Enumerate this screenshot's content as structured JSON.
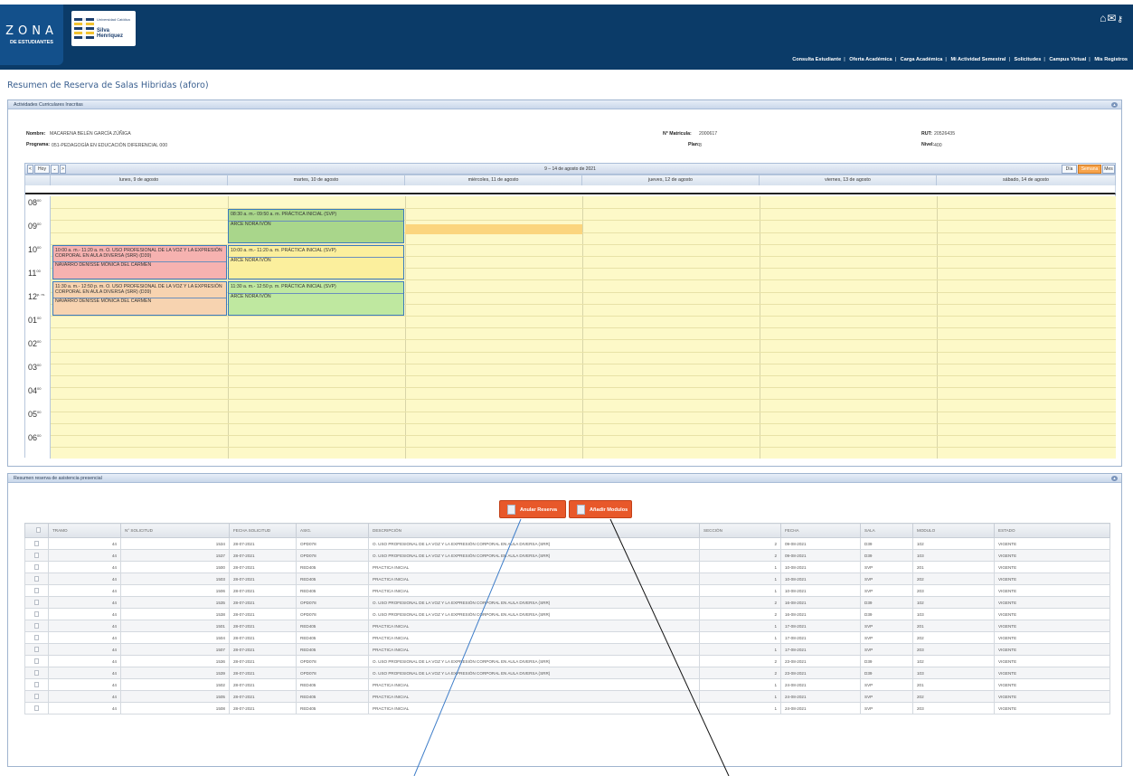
{
  "header": {
    "zona_title": "ZONA",
    "zona_subtitle": "DE ESTUDIANTES",
    "university_small": "Universidad Católica",
    "university_name": "Silva Henríquez",
    "icons": [
      "home-icon",
      "mail-icon",
      "key-icon"
    ],
    "nav": [
      "Consulta Estudiante",
      "Oferta Académica",
      "Carga Académica",
      "Mi Actividad Semestral",
      "Solicitudes",
      "Campus Virtual",
      "Mis Registros"
    ]
  },
  "page_title": "Resumen de Reserva de Salas Hibridas (aforo)",
  "panel1": {
    "title": "Actividades Curriculares Inscritas",
    "nombre_label": "Nombre:",
    "nombre": "MACARENA BELÉN GARCÍA ZÚÑIGA",
    "programa_label": "Programa:",
    "programa": "051-PEDAGOGÍA EN EDUCACIÓN DIFERENCIAL 000",
    "matricula_label": "N° Matricula:",
    "matricula": "2000617",
    "plan_label": "Plan:",
    "plan": "8",
    "rut_label": "RUT:",
    "rut": "20526435",
    "nivel_label": "Nivel:",
    "nivel": "400"
  },
  "calendar": {
    "prev": "<",
    "today": "Hoy",
    "down": "⌄",
    "next": ">",
    "range": "9 – 14 de agosto de 2021",
    "views": [
      "Día",
      "Semana Laboral",
      "Mes"
    ],
    "days": [
      "lunes, 9 de agosto",
      "martes, 10 de agosto",
      "miércoles, 11 de agosto",
      "jueves, 12 de agosto",
      "viernes, 13 de agosto",
      "sábado, 14 de agosto"
    ],
    "hours": [
      "08",
      "09",
      "10",
      "11",
      "12",
      "01",
      "02",
      "03",
      "04",
      "05",
      "06"
    ],
    "hour_suffix": [
      "00",
      "00",
      "00",
      "00",
      "p. m.",
      "00",
      "00",
      "00",
      "00",
      "00",
      "00"
    ],
    "events": [
      {
        "title": "08:30 a. m.- 09:50 a. m. PRÁCTICA INICIAL (SVP)",
        "who": "ARCE NORA IVÓN"
      },
      {
        "title": "10:00 a. m.- 11:20 a. m. O. USO PROFESIONAL DE LA VOZ Y LA EXPRESIÓN CORPORAL EN AULA DIVERSA (SRR) (D39)",
        "who": "NAVARRO DENISSE MÓNICA DEL CARMEN"
      },
      {
        "title": "10:00 a. m.- 11:20 a. m. PRÁCTICA INICIAL (SVP)",
        "who": "ARCE NORA IVÓN"
      },
      {
        "title": "11:30 a. m.- 12:50 p. m. O. USO PROFESIONAL DE LA VOZ Y LA EXPRESIÓN CORPORAL EN AULA DIVERSA (SRR) (D39)",
        "who": "NAVARRO DENISSE MÓNICA DEL CARMEN"
      },
      {
        "title": "11:30 a. m.- 12:50 p. m. PRÁCTICA INICIAL (SVP)",
        "who": "ARCE NORA IVÓN"
      }
    ]
  },
  "panel2": {
    "title": "Resumen reserva de asistencia presencial",
    "btn_anular": "Anular Reserva",
    "btn_anadir": "Añadir Modulos"
  },
  "table": {
    "headers": [
      "",
      "TRAMO",
      "N° SOLICITUD",
      "FECHA SOLICITUD",
      "ASIG.",
      "DESCRIPCIÓN",
      "SECCIÓN",
      "FECHA",
      "SALA",
      "MODULO",
      "ESTADO"
    ],
    "rows": [
      [
        "44",
        "1534",
        "28-07-2021",
        "OPD078",
        "O. USO PROFESIONAL DE LA VOZ Y LA EXPRESIÓN CORPORAL EN AULA DIVERSA (SRR)",
        "2",
        "09-08-2021",
        "D39",
        "102",
        "VIGENTE"
      ],
      [
        "44",
        "1537",
        "28-07-2021",
        "OPD078",
        "O. USO PROFESIONAL DE LA VOZ Y LA EXPRESIÓN CORPORAL EN AULA DIVERSA (SRR)",
        "2",
        "09-08-2021",
        "D39",
        "103",
        "VIGENTE"
      ],
      [
        "44",
        "1500",
        "28-07-2021",
        "RED405",
        "PRACTICA INICIAL",
        "1",
        "10-08-2021",
        "SVP",
        "201",
        "VIGENTE"
      ],
      [
        "44",
        "1503",
        "28-07-2021",
        "RED405",
        "PRACTICA INICIAL",
        "1",
        "10-08-2021",
        "SVP",
        "202",
        "VIGENTE"
      ],
      [
        "44",
        "1506",
        "28-07-2021",
        "RED405",
        "PRACTICA INICIAL",
        "1",
        "10-08-2021",
        "SVP",
        "203",
        "VIGENTE"
      ],
      [
        "44",
        "1535",
        "28-07-2021",
        "OPD078",
        "O. USO PROFESIONAL DE LA VOZ Y LA EXPRESIÓN CORPORAL EN AULA DIVERSA (SRR)",
        "2",
        "16-08-2021",
        "D39",
        "102",
        "VIGENTE"
      ],
      [
        "44",
        "1538",
        "28-07-2021",
        "OPD078",
        "O. USO PROFESIONAL DE LA VOZ Y LA EXPRESIÓN CORPORAL EN AULA DIVERSA (SRR)",
        "2",
        "16-08-2021",
        "D39",
        "103",
        "VIGENTE"
      ],
      [
        "44",
        "1501",
        "28-07-2021",
        "RED405",
        "PRACTICA INICIAL",
        "1",
        "17-08-2021",
        "SVP",
        "201",
        "VIGENTE"
      ],
      [
        "44",
        "1504",
        "28-07-2021",
        "RED405",
        "PRACTICA INICIAL",
        "1",
        "17-08-2021",
        "SVP",
        "202",
        "VIGENTE"
      ],
      [
        "44",
        "1507",
        "28-07-2021",
        "RED405",
        "PRACTICA INICIAL",
        "1",
        "17-08-2021",
        "SVP",
        "203",
        "VIGENTE"
      ],
      [
        "44",
        "1536",
        "28-07-2021",
        "OPD078",
        "O. USO PROFESIONAL DE LA VOZ Y LA EXPRESIÓN CORPORAL EN AULA DIVERSA (SRR)",
        "2",
        "23-08-2021",
        "D39",
        "102",
        "VIGENTE"
      ],
      [
        "44",
        "1539",
        "28-07-2021",
        "OPD078",
        "O. USO PROFESIONAL DE LA VOZ Y LA EXPRESIÓN CORPORAL EN AULA DIVERSA (SRR)",
        "2",
        "23-08-2021",
        "D39",
        "103",
        "VIGENTE"
      ],
      [
        "44",
        "1502",
        "28-07-2021",
        "RED405",
        "PRACTICA INICIAL",
        "1",
        "24-08-2021",
        "SVP",
        "201",
        "VIGENTE"
      ],
      [
        "44",
        "1505",
        "28-07-2021",
        "RED405",
        "PRACTICA INICIAL",
        "1",
        "24-08-2021",
        "SVP",
        "202",
        "VIGENTE"
      ],
      [
        "44",
        "1508",
        "28-07-2021",
        "RED405",
        "PRACTICA INICIAL",
        "1",
        "24-08-2021",
        "SVP",
        "203",
        "VIGENTE"
      ]
    ]
  },
  "colors": {
    "header_bg": "#0b3b68",
    "accent_orange": "#e8582a",
    "calendar_bg": "#fdf9c8",
    "title_blue": "#3a5f8f"
  }
}
